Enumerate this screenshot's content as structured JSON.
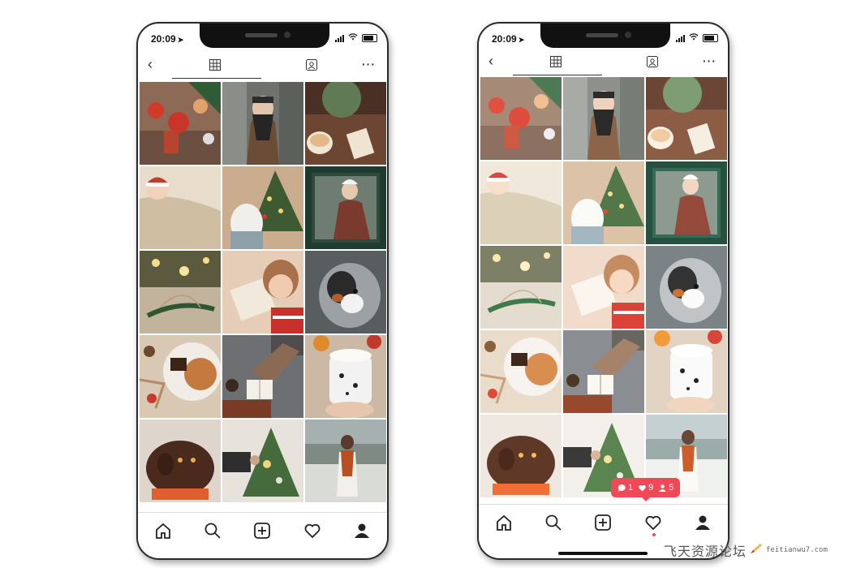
{
  "phones": [
    {
      "status": {
        "time": "20:09"
      },
      "header": {
        "back_icon": "chevron-left-icon",
        "grid_icon": "grid-icon",
        "tagged_icon": "tagged-icon",
        "more_label": "···"
      },
      "tabs": [
        "home-icon",
        "search-icon",
        "add-post-icon",
        "heart-icon",
        "profile-icon"
      ],
      "photos": [
        "holiday-drinks",
        "woman-scarf-snow",
        "candle-and-plant",
        "baby-blanket",
        "christmas-tree",
        "child-window",
        "bokeh-pine-twine",
        "child-reading",
        "australian-shepherd",
        "chocolate-pancake",
        "reading-coffee",
        "marshmallow-mug",
        "brown-labrador",
        "tree-ornaments",
        "woman-snowy-park"
      ]
    },
    {
      "status": {
        "time": "20:09"
      },
      "header": {
        "back_icon": "chevron-left-icon",
        "grid_icon": "grid-icon",
        "tagged_icon": "tagged-icon",
        "more_label": "···"
      },
      "tabs": [
        "home-icon",
        "search-icon",
        "add-post-icon",
        "heart-icon",
        "profile-icon"
      ],
      "photos": [
        "holiday-drinks",
        "woman-scarf-snow",
        "candle-and-plant",
        "baby-blanket",
        "christmas-tree",
        "child-window",
        "bokeh-pine-twine",
        "child-reading",
        "australian-shepherd",
        "chocolate-pancake",
        "reading-coffee",
        "marshmallow-mug",
        "brown-labrador",
        "tree-ornaments",
        "woman-snowy-park"
      ],
      "activity": {
        "comments": "1",
        "likes": "9",
        "follows": "5"
      }
    }
  ],
  "watermark": {
    "cn": "飞天资源论坛",
    "en": "feitianwu7.com"
  }
}
